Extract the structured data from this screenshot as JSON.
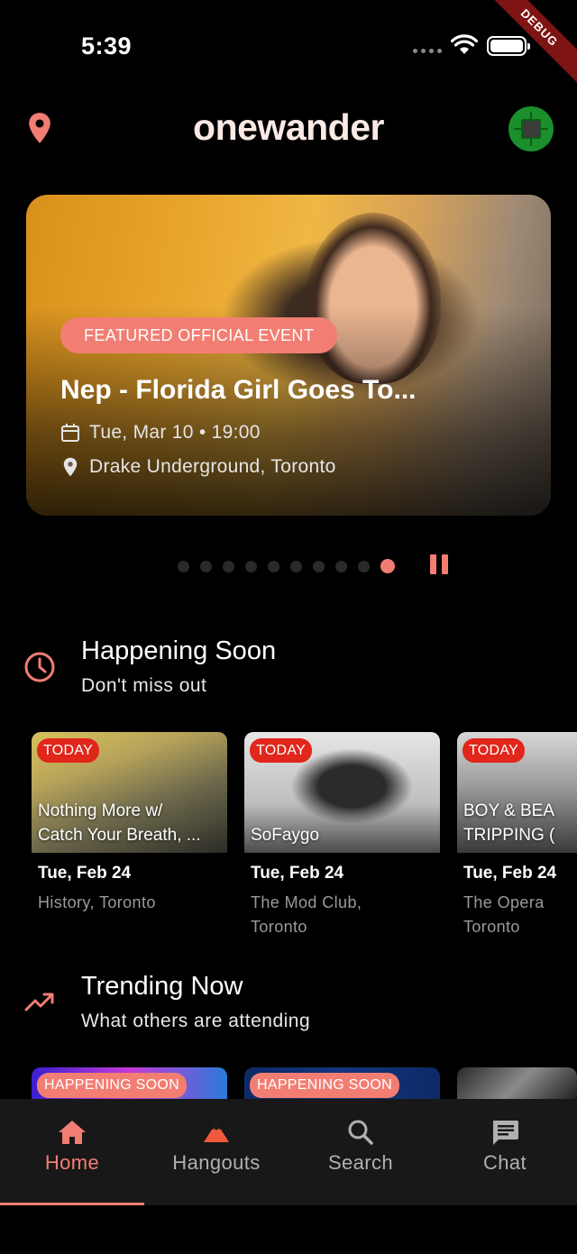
{
  "status_bar": {
    "time": "5:39",
    "debug_label": "DEBUG"
  },
  "header": {
    "logo": "onewander",
    "location_icon": "location-pin-icon",
    "avatar_icon": "chip-avatar"
  },
  "featured": {
    "badge": "FEATURED OFFICIAL EVENT",
    "title": "Nep - Florida Girl Goes To...",
    "date": "Tue, Mar 10 • 19:00",
    "location": "Drake Underground, Toronto"
  },
  "carousel": {
    "total": 10,
    "active_index": 9
  },
  "happening_soon": {
    "title": "Happening Soon",
    "subtitle": "Don't miss out",
    "cards": [
      {
        "tag": "TODAY",
        "caption": "Nothing More w/\nCatch Your Breath, ...",
        "date": "Tue, Feb 24",
        "venue": "History, Toronto"
      },
      {
        "tag": "TODAY",
        "caption": "SoFaygo",
        "date": "Tue, Feb 24",
        "venue": "The Mod Club,\nToronto"
      },
      {
        "tag": "TODAY",
        "caption": "BOY & BEA\nTRIPPING (",
        "date": "Tue, Feb 24",
        "venue": "The Opera\nToronto"
      }
    ]
  },
  "trending_now": {
    "title": "Trending Now",
    "subtitle": "What others are attending",
    "cards": [
      {
        "tag": "HAPPENING SOON"
      },
      {
        "tag": "HAPPENING SOON"
      },
      {
        "tag": ""
      }
    ]
  },
  "nav": {
    "items": [
      {
        "label": "Home",
        "icon": "home-icon"
      },
      {
        "label": "Hangouts",
        "icon": "mountain-icon"
      },
      {
        "label": "Search",
        "icon": "search-icon"
      },
      {
        "label": "Chat",
        "icon": "chat-icon"
      }
    ],
    "active": "Home"
  },
  "colors": {
    "accent": "#f27e73",
    "today_badge": "#e1261b",
    "background": "#000000",
    "nav_bg": "#181818"
  }
}
